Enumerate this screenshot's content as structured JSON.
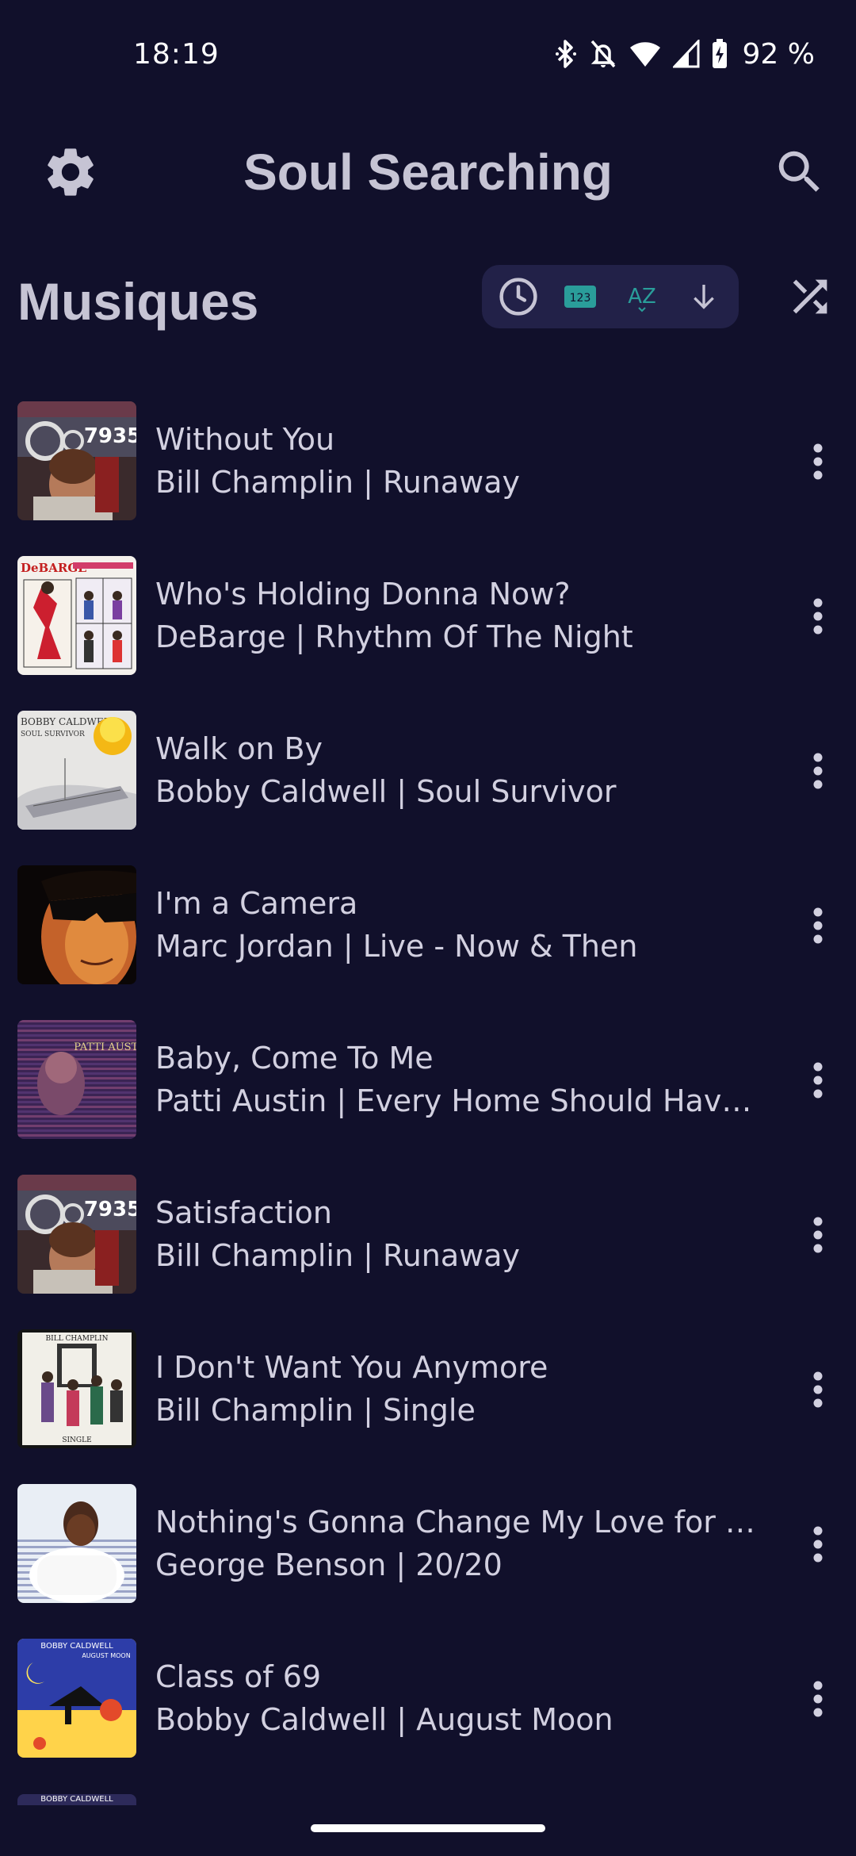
{
  "status_bar": {
    "time": "18:19",
    "battery_text": "92 %",
    "icons": [
      "bluetooth-icon",
      "bell-off-icon",
      "wifi-icon",
      "cell-signal-icon",
      "battery-charging-icon"
    ]
  },
  "app_bar": {
    "title": "Soul Searching",
    "left_icon": "gear-icon",
    "right_icon": "search-icon"
  },
  "section": {
    "title": "Musiques",
    "sort_buttons": [
      "clock-icon",
      "numeric-123-icon",
      "az-sort-icon",
      "arrow-down-icon"
    ],
    "numeric_label": "123",
    "az_label": "AZ",
    "shuffle_icon": "shuffle-icon"
  },
  "colors": {
    "background": "#11102b",
    "accent": "#2a9d9a",
    "text": "#d2d0e0",
    "title": "#c6c4d4",
    "sort_group_bg": "#222148"
  },
  "tracks": [
    {
      "title": "Without You",
      "subtitle": "Bill Champlin | Runaway",
      "art": "runaway"
    },
    {
      "title": "Who's Holding Donna Now?",
      "subtitle": "DeBarge | Rhythm Of The Night",
      "art": "debarge"
    },
    {
      "title": "Walk on By",
      "subtitle": "Bobby Caldwell | Soul Survivor",
      "art": "soulsurvivor"
    },
    {
      "title": "I'm a Camera",
      "subtitle": "Marc Jordan | Live - Now & Then",
      "art": "marcjordan"
    },
    {
      "title": "Baby, Come To Me",
      "subtitle": "Patti Austin | Every Home Should Have O…",
      "art": "pattiaustin"
    },
    {
      "title": "Satisfaction",
      "subtitle": "Bill Champlin | Runaway",
      "art": "runaway"
    },
    {
      "title": "I Don't Want You Anymore",
      "subtitle": "Bill Champlin | Single",
      "art": "champlinsingle"
    },
    {
      "title": "Nothing's Gonna Change My Love for You",
      "subtitle": "George Benson | 20/20",
      "art": "benson"
    },
    {
      "title": "Class of 69",
      "subtitle": "Bobby Caldwell | August Moon",
      "art": "augustmoon"
    }
  ],
  "art_text": {
    "runaway_number": "7935",
    "debarge_logo": "DeBARGE",
    "soulsurvivor_artist": "BOBBY CALDWELL",
    "soulsurvivor_album": "SOUL SURVIVOR",
    "patti_name": "PATTI AUSTIN",
    "champlin_name": "BILL CHAMPLIN",
    "champlin_single": "SINGLE",
    "augustmoon_artist": "BOBBY CALDWELL",
    "augustmoon_album": "AUGUST MOON"
  }
}
